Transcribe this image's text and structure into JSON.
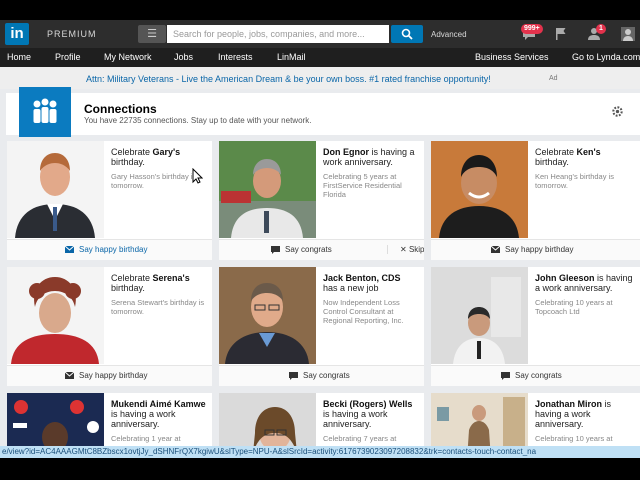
{
  "topbar": {
    "logo": "in",
    "premium_label": "PREMIUM",
    "search_menu_icon": "menu-icon",
    "search_placeholder": "Search for people, jobs, companies, and more...",
    "advanced_label": "Advanced",
    "messages_badge": "999+",
    "notifications_badge": "1"
  },
  "nav": {
    "items": [
      "Home",
      "Profile",
      "My Network",
      "Jobs",
      "Interests",
      "LinMail"
    ],
    "business_services": "Business Services",
    "lynda": "Go to Lynda.com"
  },
  "ad": {
    "text": "Attn: Military Veterans - Live the American Dream & be your own boss. #1 rated franchise opportunity!",
    "label": "Ad"
  },
  "connections": {
    "title": "Connections",
    "subtitle": "You have 22735 connections. Stay up to date with your network."
  },
  "cards": [
    {
      "prefix": "Celebrate ",
      "name": "Gary's",
      "suffix": "birthday.",
      "desc": "Gary Hasson's birthday is tomorrow.",
      "action": "Say happy birthday",
      "action_icon": "envelope-icon"
    },
    {
      "prefix": "",
      "name": "Don Egnor",
      "suffix": " is having a work anniversary.",
      "desc": "Celebrating 5 years at FirstService Residential Florida",
      "action": "Say congrats",
      "action_icon": "speech-bubble-icon",
      "skip": "Skip"
    },
    {
      "prefix": "Celebrate ",
      "name": "Ken's",
      "suffix": "birthday.",
      "desc": "Ken Heang's birthday is tomorrow.",
      "action": "Say happy birthday",
      "action_icon": "envelope-icon"
    },
    {
      "prefix": "Celebrate ",
      "name": "Serena's",
      "suffix": "birthday.",
      "desc": "Serena Stewart's birthday is tomorrow.",
      "action": "Say happy birthday",
      "action_icon": "envelope-icon"
    },
    {
      "prefix": "",
      "name": "Jack Benton, CDS",
      "suffix": " has a new job",
      "desc": "Now Independent Loss Control Consultant at Regional Reporting, Inc.",
      "action": "Say congrats",
      "action_icon": "speech-bubble-icon"
    },
    {
      "prefix": "",
      "name": "John Gleeson",
      "suffix": " is having a work anniversary.",
      "desc": "Celebrating 10 years at Topcoach Ltd",
      "action": "Say congrats",
      "action_icon": "speech-bubble-icon"
    },
    {
      "prefix": "",
      "name": "Mukendi Aimé Kamwe",
      "suffix": " is having a work anniversary.",
      "desc": "Celebrating 1 year at",
      "action": "",
      "action_icon": ""
    },
    {
      "prefix": "",
      "name": "Becki (Rogers) Wells",
      "suffix": " is having a work anniversary.",
      "desc": "Celebrating 7 years at",
      "action": "",
      "action_icon": ""
    },
    {
      "prefix": "",
      "name": "Jonathan Miron",
      "suffix": " is having a work anniversary.",
      "desc": "Celebrating 10 years at",
      "action": "",
      "action_icon": ""
    }
  ],
  "status_url": "e/view?id=AC4AAAGMtC8BZbscx1ovtjJy_dSHNFrQX7kgiwU&slType=NPU-A&slSrcId=activity:6176739023097208832&trk=contacts-touch-contact_na",
  "colors": {
    "accent": "#0077b5",
    "nav_bg": "#1f1f1f",
    "topbar_bg": "#2d2d2d",
    "badge": "#e3324c"
  }
}
